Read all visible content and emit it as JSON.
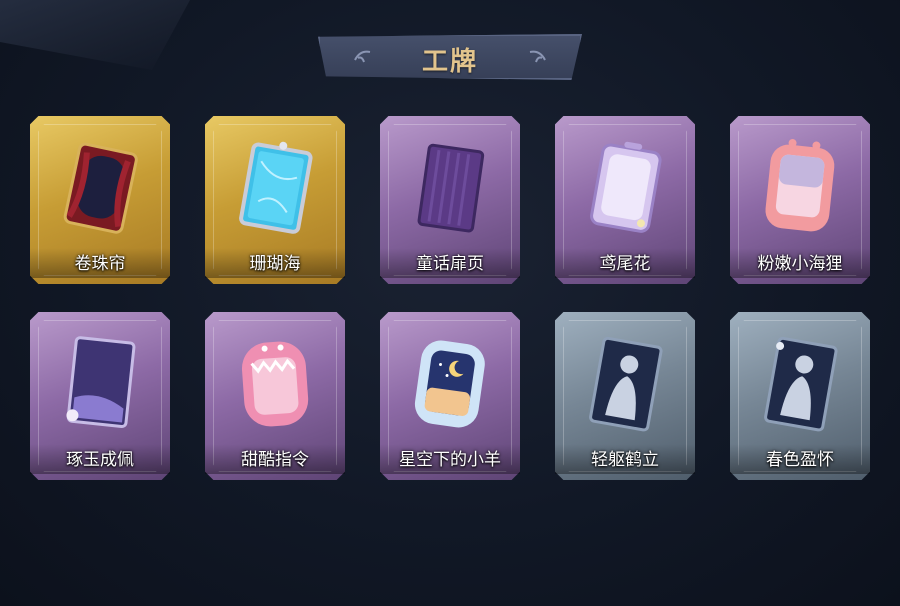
{
  "header": {
    "title": "工牌"
  },
  "cards": [
    {
      "label": "卷珠帘",
      "rarity": "gold",
      "art": "dark-red-curtain-badge"
    },
    {
      "label": "珊瑚海",
      "rarity": "gold",
      "art": "blue-ocean-badge"
    },
    {
      "label": "童话扉页",
      "rarity": "purple",
      "art": "purple-page-badge"
    },
    {
      "label": "鸢尾花",
      "rarity": "purple",
      "art": "lavender-badge"
    },
    {
      "label": "粉嫩小海狸",
      "rarity": "purple",
      "art": "pink-beaver-badge"
    },
    {
      "label": "琢玉成佩",
      "rarity": "purple",
      "art": "jade-purple-badge"
    },
    {
      "label": "甜酷指令",
      "rarity": "purple",
      "art": "pink-shark-badge"
    },
    {
      "label": "星空下的小羊",
      "rarity": "purple",
      "art": "starry-sheep-badge"
    },
    {
      "label": "轻躯鹤立",
      "rarity": "grey",
      "art": "silhouette-badge"
    },
    {
      "label": "春色盈怀",
      "rarity": "grey",
      "art": "silhouette-badge"
    }
  ],
  "colors": {
    "background": "#111826",
    "title_gold": "#e2c48d",
    "gold_card": "#c79d35",
    "purple_card": "#8d6aa6",
    "grey_card": "#778796"
  }
}
